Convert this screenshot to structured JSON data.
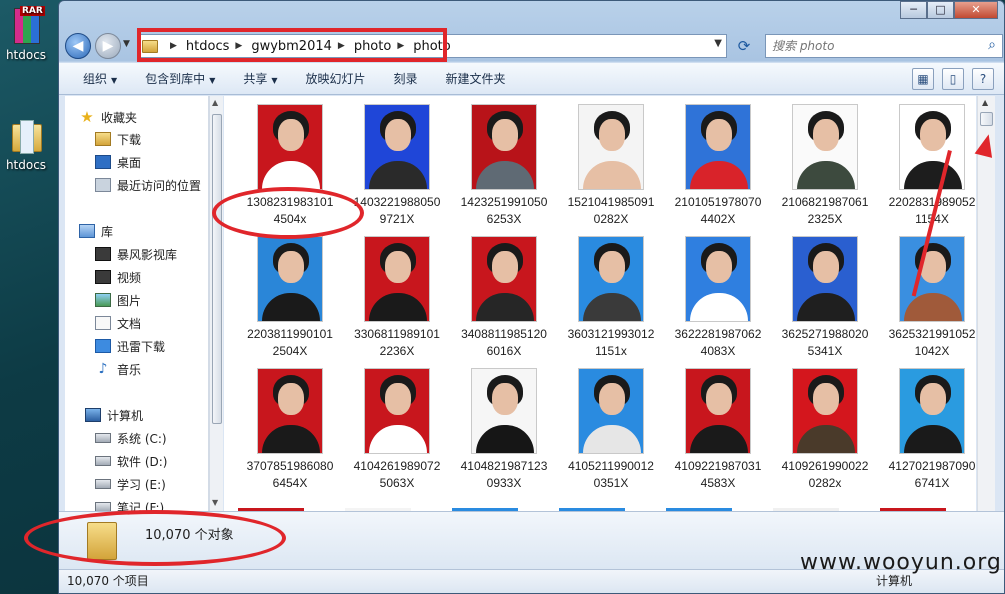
{
  "desktop": {
    "icons": [
      {
        "label": "htdocs",
        "badge": "RAR",
        "icon": "winrar-archive-icon"
      },
      {
        "label": "htdocs",
        "icon": "folder-icon"
      }
    ]
  },
  "window": {
    "caption_buttons": {
      "minimize": "─",
      "maximize": "□",
      "close": "✕"
    }
  },
  "address": {
    "crumbs": [
      "htdocs",
      "gwybm2014",
      "photo",
      "photo"
    ]
  },
  "search": {
    "placeholder": "搜索 photo"
  },
  "toolbar": {
    "items": [
      "组织",
      "包含到库中",
      "共享",
      "放映幻灯片",
      "刻录",
      "新建文件夹"
    ]
  },
  "navpane": {
    "favorites_title": "收藏夹",
    "favorites": [
      "下载",
      "桌面",
      "最近访问的位置"
    ],
    "libraries_title": "库",
    "libraries": [
      "暴风影视库",
      "视频",
      "图片",
      "文档",
      "迅雷下载",
      "音乐"
    ],
    "computer_title": "计算机",
    "drives": [
      "系统 (C:)",
      "软件 (D:)",
      "学习 (E:)",
      "笔记 (F:)"
    ]
  },
  "files": [
    {
      "l1": "1308231983101",
      "l2": "4504x",
      "bg": "#c8161d",
      "shirt": "#ffffff"
    },
    {
      "l1": "1403221988050",
      "l2": "9721X",
      "bg": "#1f46d8",
      "shirt": "#2a2a2a"
    },
    {
      "l1": "1423251991050",
      "l2": "6253X",
      "bg": "#b81319",
      "shirt": "#5f6a74"
    },
    {
      "l1": "1521041985091",
      "l2": "0282X",
      "bg": "#f4f4f4",
      "shirt": "#e6bfa5"
    },
    {
      "l1": "2101051978070",
      "l2": "4402X",
      "bg": "#2f73d8",
      "shirt": "#d9232a"
    },
    {
      "l1": "2106821987061",
      "l2": "2325X",
      "bg": "#fafafa",
      "shirt": "#3d4a3e"
    },
    {
      "l1": "2202831989052",
      "l2": "1154X",
      "bg": "#ffffff",
      "shirt": "#1d1d1d"
    },
    {
      "l1": "2203811990101",
      "l2": "2504X",
      "bg": "#2a86d8",
      "shirt": "#1a1a1a"
    },
    {
      "l1": "3306811989101",
      "l2": "2236X",
      "bg": "#c8161d",
      "shirt": "#1a1a1a"
    },
    {
      "l1": "3408811985120",
      "l2": "6016X",
      "bg": "#c8161d",
      "shirt": "#262626"
    },
    {
      "l1": "3603121993012",
      "l2": "1151x",
      "bg": "#2a8be0",
      "shirt": "#3a3a3a"
    },
    {
      "l1": "3622281987062",
      "l2": "4083X",
      "bg": "#2f7fe0",
      "shirt": "#ffffff"
    },
    {
      "l1": "3625271988020",
      "l2": "5341X",
      "bg": "#2a5fd0",
      "shirt": "#1f1f1f"
    },
    {
      "l1": "3625321991052",
      "l2": "1042X",
      "bg": "#3a8fe0",
      "shirt": "#a05a3a"
    },
    {
      "l1": "3707851986080",
      "l2": "6454X",
      "bg": "#c8161d",
      "shirt": "#1a1a1a"
    },
    {
      "l1": "4104261989072",
      "l2": "5063X",
      "bg": "#c8161d",
      "shirt": "#ffffff"
    },
    {
      "l1": "4104821987123",
      "l2": "0933X",
      "bg": "#f6f6f6",
      "shirt": "#161616"
    },
    {
      "l1": "4105211990012",
      "l2": "0351X",
      "bg": "#2a8be0",
      "shirt": "#e6e6e6"
    },
    {
      "l1": "4109221987031",
      "l2": "4583X",
      "bg": "#c8161d",
      "shirt": "#1a1a1a"
    },
    {
      "l1": "4109261990022",
      "l2": "0282x",
      "bg": "#d4161d",
      "shirt": "#4a3a2a"
    },
    {
      "l1": "4127021987090",
      "l2": "6741X",
      "bg": "#2a9be0",
      "shirt": "#1a1a1a"
    }
  ],
  "next_row_edge_colors": [
    "#c8161d",
    "#f4f4f4",
    "#2a8be0",
    "#2a8be0",
    "#2a8be0",
    "#f0f0f0",
    "#c8161d"
  ],
  "details": {
    "count_text": "10,070 个对象"
  },
  "status": {
    "items_text": "10,070 个项目",
    "location": "计算机"
  },
  "watermark": "www.wooyun.org"
}
